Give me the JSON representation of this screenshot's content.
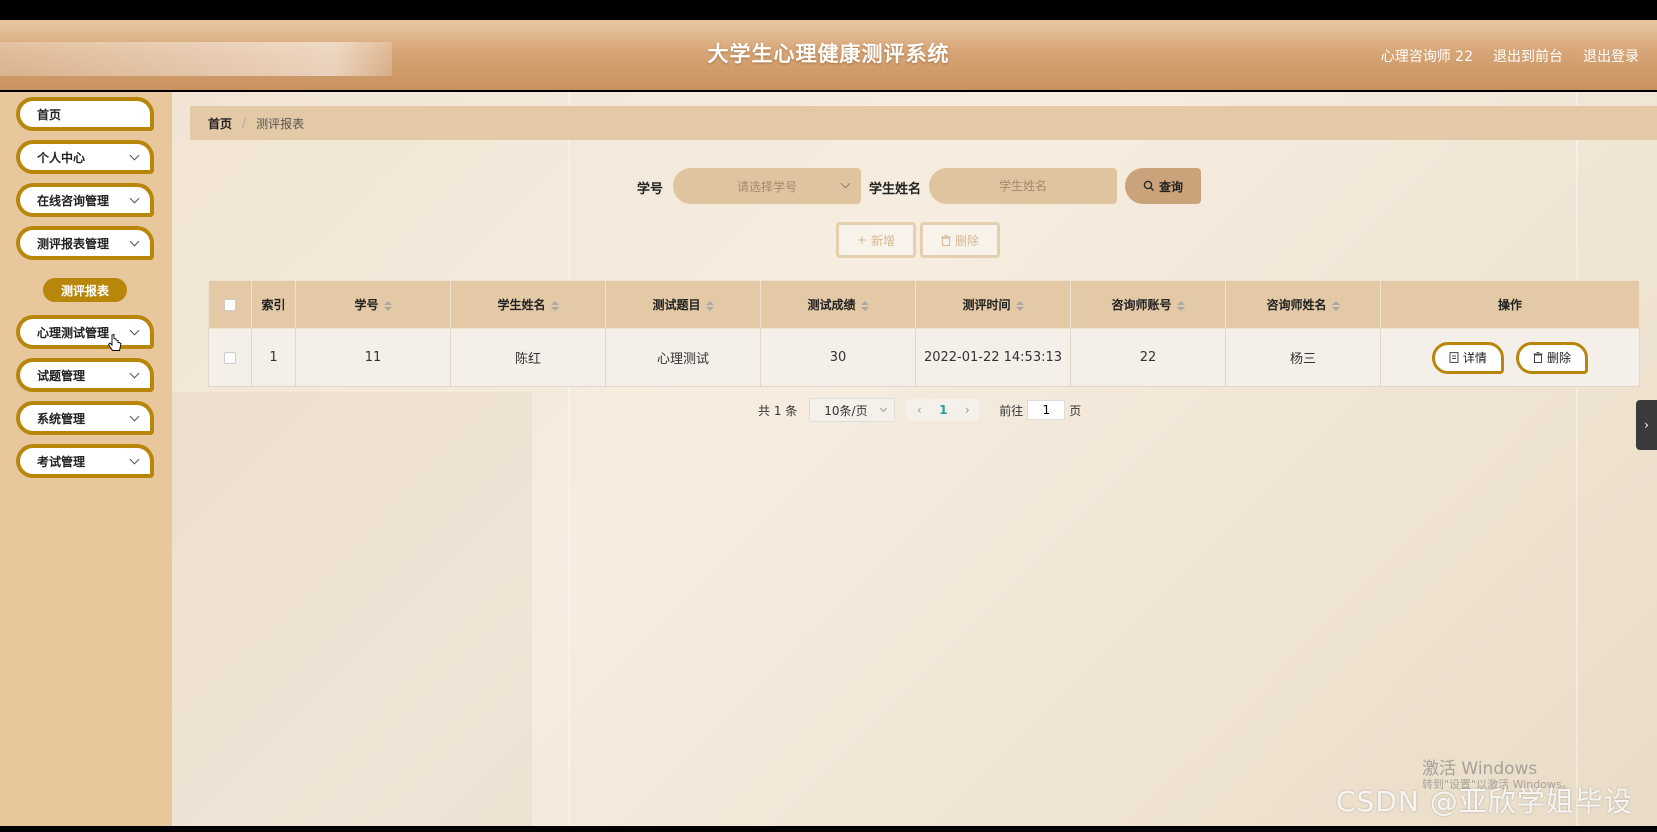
{
  "header": {
    "title": "大学生心理健康测评系统",
    "user": "心理咨询师 22",
    "back_to_front": "退出到前台",
    "logout": "退出登录"
  },
  "sidebar": {
    "items": [
      {
        "label": "首页",
        "has_children": false
      },
      {
        "label": "个人中心",
        "has_children": true
      },
      {
        "label": "在线咨询管理",
        "has_children": true
      },
      {
        "label": "测评报表管理",
        "has_children": true
      },
      {
        "label": "心理测试管理",
        "has_children": true
      },
      {
        "label": "试题管理",
        "has_children": true
      },
      {
        "label": "系统管理",
        "has_children": true
      },
      {
        "label": "考试管理",
        "has_children": true
      }
    ],
    "active_sub": "测评报表"
  },
  "breadcrumb": {
    "home": "首页",
    "separator": "/",
    "current": "测评报表"
  },
  "search": {
    "student_id_label": "学号",
    "student_id_placeholder": "请选择学号",
    "student_name_label": "学生姓名",
    "student_name_placeholder": "学生姓名",
    "query_label": "查询"
  },
  "actions": {
    "add_label": "新增",
    "delete_label": "删除"
  },
  "table": {
    "columns": [
      "索引",
      "学号",
      "学生姓名",
      "测试题目",
      "测试成绩",
      "测评时间",
      "咨询师账号",
      "咨询师姓名",
      "操作"
    ],
    "rows": [
      {
        "index": "1",
        "student_id": "11",
        "student_name": "陈红",
        "test_topic": "心理测试",
        "score": "30",
        "time": "2022-01-22 14:53:13",
        "counselor_account": "22",
        "counselor_name": "杨三"
      }
    ],
    "detail_label": "详情",
    "delete_label": "删除"
  },
  "pagination": {
    "total_text": "共 1 条",
    "page_size": "10条/页",
    "current_page": "1",
    "goto_label": "前往",
    "goto_value": "1",
    "page_suffix": "页"
  },
  "watermark": {
    "activate_title": "激活 Windows",
    "activate_sub": "转到\"设置\"以激活 Windows。",
    "csdn": "CSDN @亚欣学姐毕设"
  },
  "icons": {
    "search": "search-icon",
    "plus": "plus-icon",
    "trash": "trash-icon",
    "doc": "document-icon",
    "chevron": "chevron-down-icon"
  },
  "colors": {
    "accent": "#b8860b",
    "header": "#d7a577",
    "sidebar_bg": "#e8c79c",
    "table_header": "#e3c9a5",
    "page_current": "#1aa39c"
  }
}
